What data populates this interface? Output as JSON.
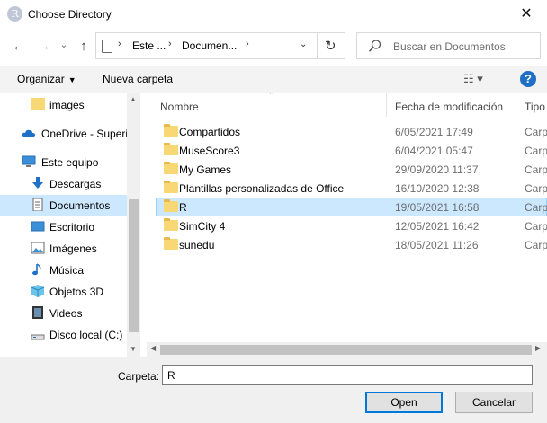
{
  "window": {
    "title": "Choose Directory",
    "icon_letter": "R",
    "close_glyph": "✕"
  },
  "nav": {
    "back": "←",
    "forward": "→",
    "recent": "⌄",
    "up": "↑"
  },
  "address": {
    "crumbs": [
      "Este ...",
      "Documen..."
    ],
    "refresh": "↻"
  },
  "search": {
    "placeholder": "Buscar en Documentos"
  },
  "toolbar": {
    "organize": "Organizar",
    "new_folder": "Nueva carpeta",
    "help": "?"
  },
  "sidebar": {
    "items": [
      {
        "label": "images",
        "icon": "folder-icon"
      },
      {
        "label": "OneDrive - Superi",
        "icon": "cloud-icon"
      },
      {
        "label": "Este equipo",
        "icon": "computer-icon"
      },
      {
        "label": "Descargas",
        "icon": "download-icon"
      },
      {
        "label": "Documentos",
        "icon": "document-icon",
        "selected": true
      },
      {
        "label": "Escritorio",
        "icon": "desktop-icon"
      },
      {
        "label": "Imágenes",
        "icon": "pictures-icon"
      },
      {
        "label": "Música",
        "icon": "music-icon"
      },
      {
        "label": "Objetos 3D",
        "icon": "cube-icon"
      },
      {
        "label": "Videos",
        "icon": "video-icon"
      },
      {
        "label": "Disco local (C:)",
        "icon": "drive-icon"
      }
    ]
  },
  "columns": {
    "name": "Nombre",
    "date": "Fecha de modificación",
    "type": "Tipo"
  },
  "files": [
    {
      "name": "Compartidos",
      "date": "6/05/2021 17:49",
      "type": "Carp"
    },
    {
      "name": "MuseScore3",
      "date": "6/04/2021 05:47",
      "type": "Carp"
    },
    {
      "name": "My Games",
      "date": "29/09/2020 11:37",
      "type": "Carp"
    },
    {
      "name": "Plantillas personalizadas de Office",
      "date": "16/10/2020 12:38",
      "type": "Carp"
    },
    {
      "name": "R",
      "date": "19/05/2021 16:58",
      "type": "Carp",
      "selected": true
    },
    {
      "name": "SimCity 4",
      "date": "12/05/2021 16:42",
      "type": "Carp"
    },
    {
      "name": "sunedu",
      "date": "18/05/2021 11:26",
      "type": "Carp"
    }
  ],
  "footer": {
    "folder_label": "Carpeta:",
    "folder_value": "R",
    "open": "Open",
    "cancel": "Cancelar"
  },
  "colors": {
    "selection": "#cce8ff",
    "accent": "#0078d7",
    "folder": "#f8d775"
  }
}
